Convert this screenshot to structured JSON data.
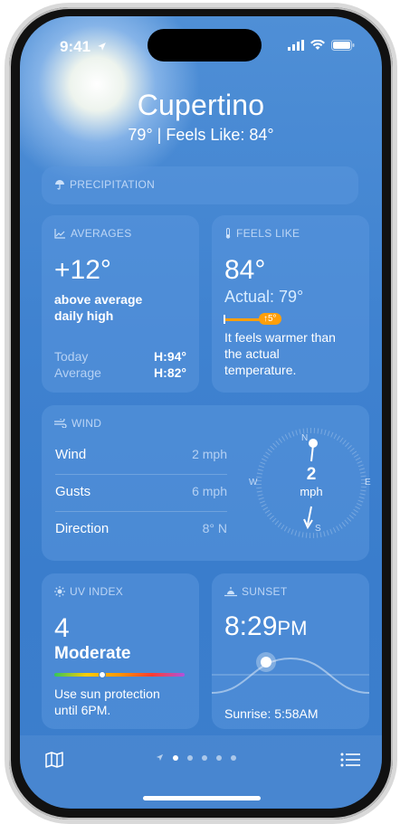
{
  "status": {
    "time": "9:41"
  },
  "header": {
    "city": "Cupertino",
    "temps": "79° | Feels Like: 84°"
  },
  "precipitation": {
    "label": "PRECIPITATION"
  },
  "averages": {
    "label": "AVERAGES",
    "value": "+12°",
    "desc_line1": "above average",
    "desc_line2": "daily high",
    "today_label": "Today",
    "today_value": "H:94°",
    "avg_label": "Average",
    "avg_value": "H:82°"
  },
  "feels_like": {
    "label": "FEELS LIKE",
    "value": "84°",
    "actual": "Actual: 79°",
    "delta_badge": "↑5°",
    "desc_line1": "It feels warmer than",
    "desc_line2": "the actual",
    "desc_line3": "temperature."
  },
  "wind": {
    "label": "WIND",
    "rows": [
      {
        "k": "Wind",
        "v": "2 mph"
      },
      {
        "k": "Gusts",
        "v": "6 mph"
      },
      {
        "k": "Direction",
        "v": "8° N"
      }
    ],
    "compass": {
      "n": "N",
      "s": "S",
      "e": "E",
      "w": "W",
      "speed": "2",
      "unit": "mph"
    }
  },
  "uv": {
    "label": "UV INDEX",
    "value": "4",
    "level": "Moderate",
    "desc_line1": "Use sun protection",
    "desc_line2": "until 6PM."
  },
  "sunset": {
    "label": "SUNSET",
    "time": "8:29",
    "ampm": "PM",
    "sunrise": "Sunrise: 5:58AM"
  },
  "nav": {
    "page_count": 6,
    "active_page": 1
  },
  "colors": {
    "sky": "#3f82d0",
    "card": "#5a96dc",
    "accent_orange": "#ff9f0a"
  },
  "icons": [
    "location-arrow-icon",
    "signal-icon",
    "wifi-icon",
    "battery-icon",
    "umbrella-icon",
    "chart-icon",
    "thermometer-icon",
    "wind-icon",
    "sun-icon",
    "sunset-icon",
    "map-icon",
    "list-icon"
  ]
}
